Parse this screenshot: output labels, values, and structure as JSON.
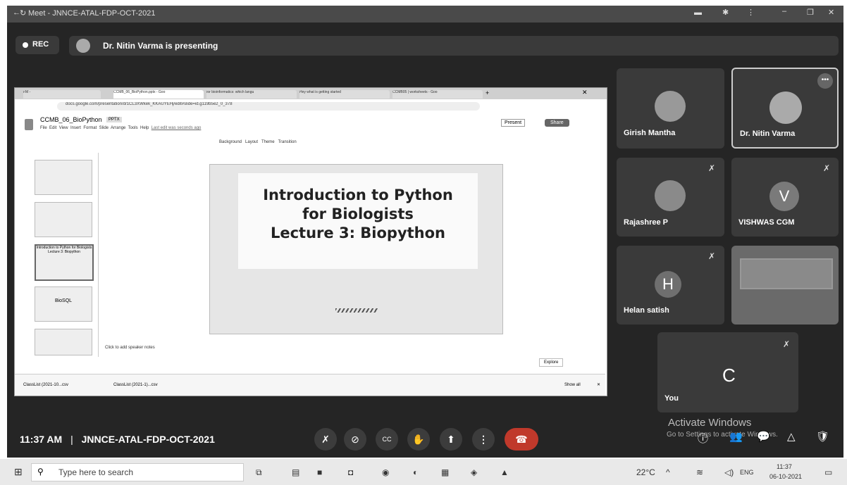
{
  "window": {
    "title": "Meet - JNNCE-ATAL-FDP-OCT-2021"
  },
  "rec": {
    "label": "REC"
  },
  "presenter": {
    "text": "Dr. Nitin Varma is presenting"
  },
  "browser": {
    "tabs": [
      "FM - ",
      "CCMB_06_BioPython.pptx - Goo",
      "for bioinformatics: which langu",
      "Hey what is getting started",
      "CCMB05 | worksheets - Goo"
    ],
    "url": "docs.google.com/presentation/d/1CL3XWkek_KKAUYEHj/edit#slide=id.g119b5e2_0_378"
  },
  "slides_app": {
    "doc_title": "CCMB_06_BioPython",
    "doc_badge": "PPTX",
    "menu": [
      "File",
      "Edit",
      "View",
      "Insert",
      "Format",
      "Slide",
      "Arrange",
      "Tools",
      "Help"
    ],
    "last_edit": "Last edit was seconds ago",
    "toolbar": [
      "Background",
      "Layout",
      "Theme",
      "Transition"
    ],
    "present_label": "Present",
    "share_label": "Share",
    "speaker_notes": "Click to add speaker notes",
    "explore_label": "Explore",
    "thumb1": "Introduction to Python for Biologists Lecture 3: Biopython",
    "thumb2": "BioSQL",
    "slide": {
      "line1": "Introduction to Python",
      "line2": "for Biologists",
      "line3": "Lecture 3: Biopython"
    },
    "downloads": [
      "ClassList (2021-10...csv",
      "ClassList (2021-1)...csv"
    ],
    "show_all": "Show all"
  },
  "participants": [
    {
      "name": "Girish Mantha"
    },
    {
      "name": "Dr. Nitin Varma"
    },
    {
      "name": "Rajashree P"
    },
    {
      "name": "VISHWAS CGM",
      "initial": "V",
      "color": "#7a7a7a"
    },
    {
      "name": "Helan satish",
      "initial": "H",
      "color": "#6f6f6f"
    },
    {
      "name": "You",
      "initial": "C"
    }
  ],
  "footer": {
    "time": "11:37 AM",
    "separator": "|",
    "meeting": "JNNCE-ATAL-FDP-OCT-2021"
  },
  "activate": {
    "line1": "Activate Windows",
    "line2": "Go to Settings to activate Windows."
  },
  "taskbar": {
    "search_placeholder": "Type here to search",
    "weather": "22°C",
    "lang": "ENG",
    "time": "11:37",
    "date": "06-10-2021"
  },
  "colors": {
    "end_call": "#c0392b",
    "meet_bg": "#252525",
    "control": "#3c3c3c"
  }
}
